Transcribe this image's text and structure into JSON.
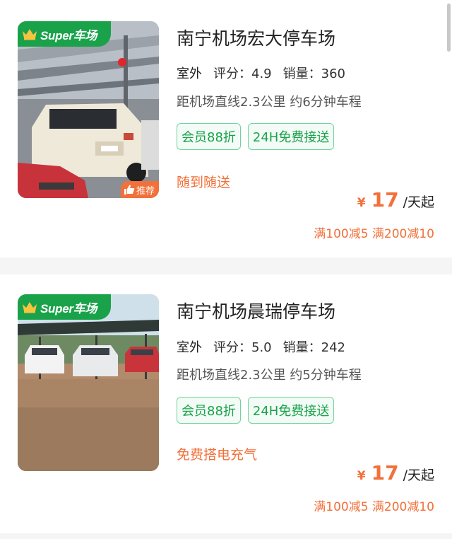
{
  "listings": [
    {
      "super_badge": "Super车场",
      "recommend_badge": "推荐",
      "title": "南宁机场宏大停车场",
      "type": "室外",
      "rating": "评分：4.9",
      "sales": "销量：360",
      "distance": "距机场直线2.3公里 约6分钟车程",
      "tags": [
        "会员88折",
        "24H免费接送"
      ],
      "promo": "随到随送",
      "price_symbol": "¥",
      "price": "17",
      "price_unit": "/天起",
      "discount": "满100减5 满200减10"
    },
    {
      "super_badge": "Super车场",
      "title": "南宁机场晨瑞停车场",
      "type": "室外",
      "rating": "评分：5.0",
      "sales": "销量：242",
      "distance": "距机场直线2.3公里 约5分钟车程",
      "tags": [
        "会员88折",
        "24H免费接送"
      ],
      "promo": "免费搭电充气",
      "price_symbol": "¥",
      "price": "17",
      "price_unit": "/天起",
      "discount": "满100减5 满200减10"
    }
  ],
  "colors": {
    "brand_green": "#19a24a",
    "accent_orange": "#f2703a",
    "tag_border": "#6fd49a"
  },
  "icons": [
    "crown-icon",
    "thumbs-up-icon"
  ]
}
